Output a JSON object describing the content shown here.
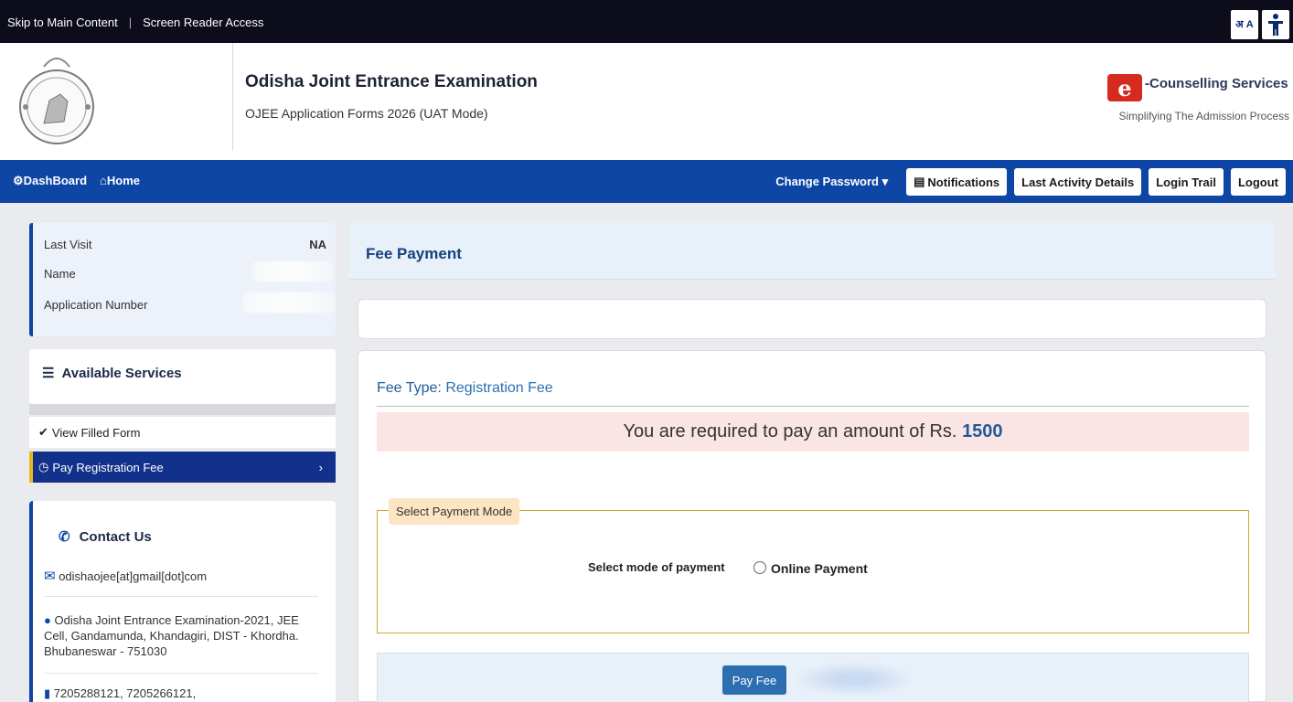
{
  "topbar": {
    "skip_link": "Skip to Main Content",
    "separator": "|",
    "screen_reader": "Screen Reader Access",
    "text_size_icon": "अ A",
    "accessibility_icon": "accessibility-icon"
  },
  "header": {
    "title": "Odisha Joint Entrance Examination",
    "subtitle": "OJEE Application Forms 2026 (UAT Mode)",
    "brand_logo_letter": "e",
    "brand_title": "-Counselling Services",
    "brand_tagline": "Simplifying The Admission Process"
  },
  "nav": {
    "dashboard": "DashBoard",
    "home": "Home",
    "change_password": "Change Password",
    "notifications": "Notifications",
    "last_activity": "Last Activity Details",
    "login_trail": "Login Trail",
    "logout": "Logout"
  },
  "profile": {
    "last_visit_label": "Last Visit",
    "last_visit_value": "NA",
    "name_label": "Name",
    "app_number_label": "Application Number"
  },
  "services": {
    "heading": "Available Services",
    "items": [
      {
        "label": "View Filled Form"
      },
      {
        "label": "Pay Registration Fee"
      }
    ]
  },
  "contact": {
    "heading": "Contact Us",
    "email": "odishaojee[at]gmail[dot]com",
    "address": "Odisha Joint Entrance Examination-2021, JEE Cell, Gandamunda, Khandagiri, DIST - Khordha. Bhubaneswar - 751030",
    "phone": "7205288121, 7205266121,"
  },
  "main": {
    "page_title": "Fee Payment",
    "fee_type_label": "Fee Type:",
    "fee_type_value": "Registration Fee",
    "amount_text": "You are required to pay an amount of Rs.",
    "amount": "1500",
    "payment_mode_legend": "Select Payment Mode",
    "mode_label": "Select mode of payment",
    "mode_option": "Online Payment",
    "pay_button": "Pay Fee"
  },
  "colors": {
    "nav_blue": "#0e46a5",
    "active_item": "#12318a",
    "accent_gold": "#e6b91a",
    "amount_blue": "#1d5b99"
  }
}
